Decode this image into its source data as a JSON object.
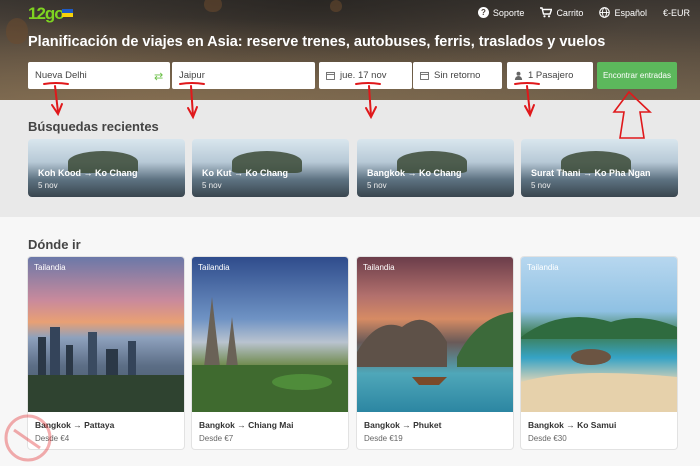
{
  "header": {
    "logo": "12go",
    "nav": [
      {
        "label": "Soporte",
        "icon": "help-icon"
      },
      {
        "label": "Carrito",
        "icon": "cart-icon"
      },
      {
        "label": "Español",
        "icon": "globe-icon"
      },
      {
        "label": "€-EUR",
        "icon": ""
      }
    ],
    "title": "Planificación de viajes en Asia: reserve trenes, autobuses, ferris, traslados y vuelos"
  },
  "search": {
    "from": "Nueva Delhi",
    "to": "Jaipur",
    "date": "jue. 17 nov",
    "return": "Sin retorno",
    "passengers": "1 Pasajero",
    "button": "Encontrar entradas"
  },
  "recent": {
    "heading": "Búsquedas recientes",
    "items": [
      {
        "route": "Koh Kood → Ko Chang",
        "date": "5 nov"
      },
      {
        "route": "Ko Kut → Ko Chang",
        "date": "5 nov"
      },
      {
        "route": "Bangkok → Ko Chang",
        "date": "5 nov"
      },
      {
        "route": "Surat Thani → Ko Pha Ngan",
        "date": "5 nov"
      }
    ]
  },
  "destinations": {
    "heading": "Dónde ir",
    "items": [
      {
        "country": "Tailandia",
        "route": "Bangkok → Pattaya",
        "price": "Desde €4"
      },
      {
        "country": "Tailandia",
        "route": "Bangkok → Chiang Mai",
        "price": "Desde €7"
      },
      {
        "country": "Tailandia",
        "route": "Bangkok → Phuket",
        "price": "Desde €19"
      },
      {
        "country": "Tailandia",
        "route": "Bangkok → Ko Samui",
        "price": "Desde €30"
      }
    ]
  },
  "colors": {
    "accent": "#5cb85c",
    "annotation": "#e0181b"
  }
}
